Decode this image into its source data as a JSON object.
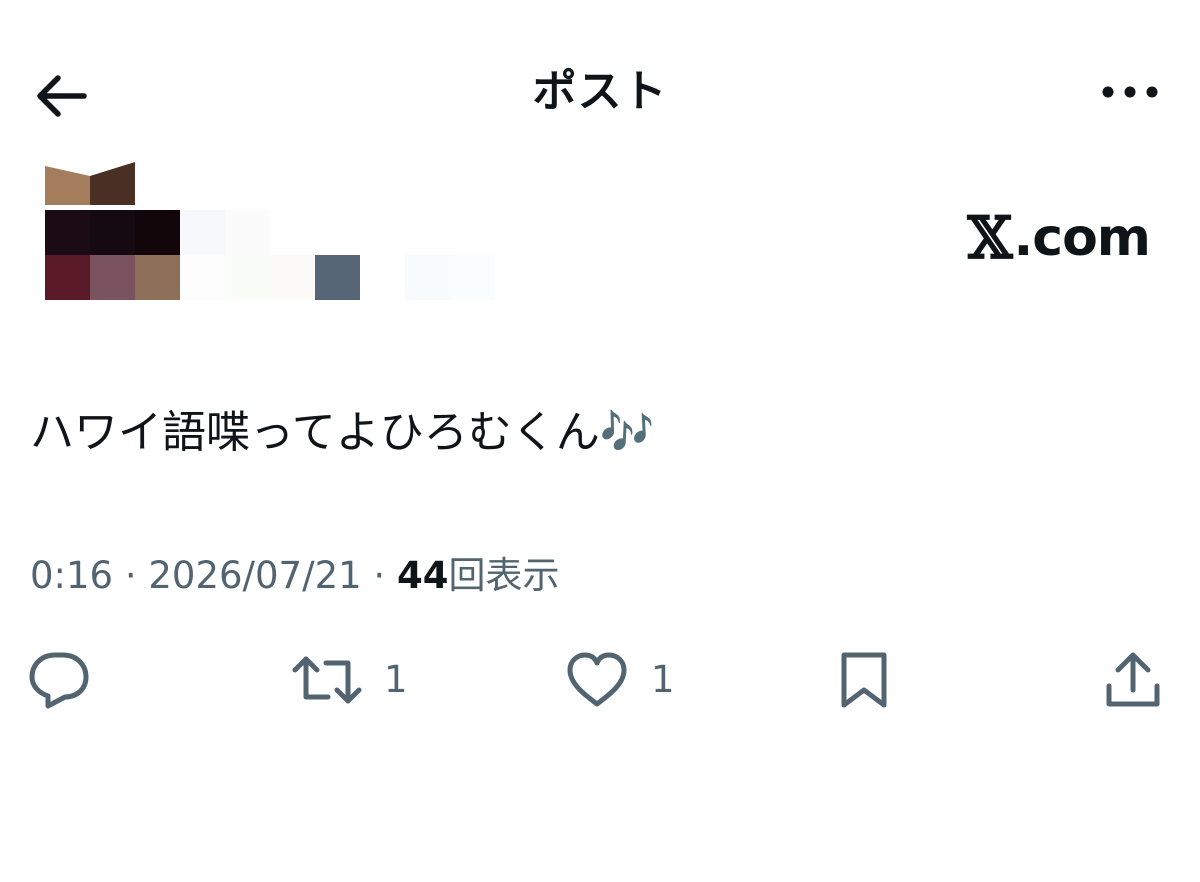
{
  "header": {
    "title": "ポスト",
    "back_icon": "arrow-left-icon",
    "more_icon": "more-horizontal-icon"
  },
  "watermark": {
    "x": "𝕏",
    "domain": ".com"
  },
  "post": {
    "text": "ハワイ語喋ってよひろむくん🎶",
    "time": "0:16",
    "sep1": " · ",
    "date": "2026/07/21",
    "sep2": " · ",
    "views_count": "44",
    "views_label": "回表示"
  },
  "actions": {
    "reply": {
      "icon": "reply-icon",
      "count": ""
    },
    "repost": {
      "icon": "repost-icon",
      "count": "1"
    },
    "like": {
      "icon": "heart-icon",
      "count": "1"
    },
    "bookmark": {
      "icon": "bookmark-icon",
      "count": ""
    },
    "share": {
      "icon": "share-icon",
      "count": ""
    }
  },
  "colors": {
    "text_primary": "#0f1419",
    "text_secondary": "#536471",
    "icon": "#536471",
    "background": "#ffffff"
  }
}
